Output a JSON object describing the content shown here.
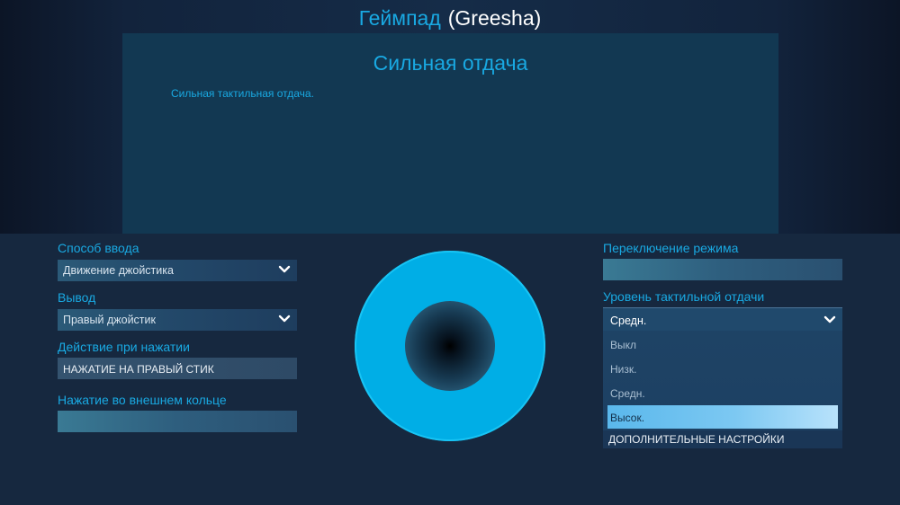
{
  "header": {
    "title": "Геймпад",
    "user": "(Greesha)"
  },
  "description": {
    "title": "Сильная отдача",
    "text": "Сильная тактильная отдача."
  },
  "left_panel": {
    "input_method": {
      "label": "Способ ввода",
      "value": "Движение джойстика"
    },
    "output": {
      "label": "Вывод",
      "value": "Правый джойстик"
    },
    "click_action": {
      "label": "Действие при нажатии",
      "value": "НАЖАТИЕ НА ПРАВЫЙ СТИК"
    },
    "outer_ring": {
      "label": "Нажатие во внешнем кольце",
      "value": ""
    }
  },
  "right_panel": {
    "mode_shift": {
      "label": "Переключение режима",
      "value": ""
    },
    "haptic_level": {
      "label": "Уровень тактильной отдачи",
      "value": "Средн.",
      "options": [
        "Выкл",
        "Низк.",
        "Средн.",
        "Высок."
      ],
      "highlighted": "Высок."
    },
    "more_settings": "ДОПОЛНИТЕЛЬНЫЕ НАСТРОЙКИ"
  },
  "colors": {
    "accent": "#19a9e2",
    "stick_ring": "#00aee6",
    "highlight": "#7cc8f2"
  }
}
